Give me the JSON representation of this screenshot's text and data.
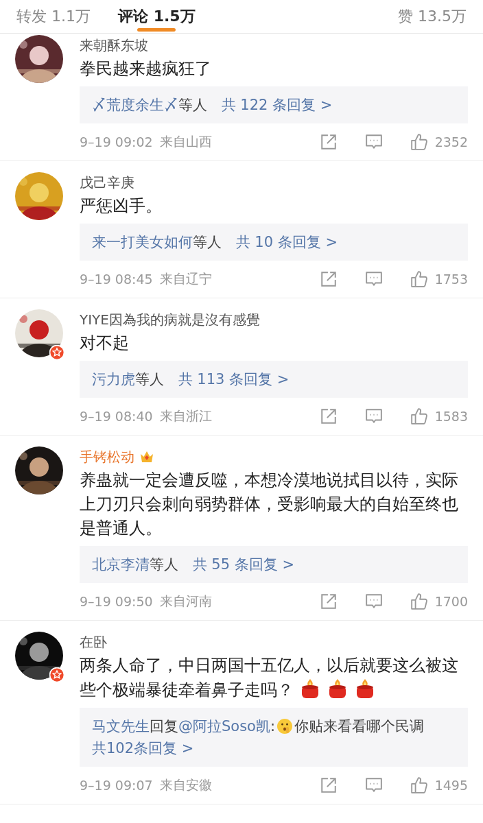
{
  "tabs": [
    {
      "label": "转发 1.1万",
      "selected": false
    },
    {
      "label": "评论 1.5万",
      "selected": true
    },
    {
      "label": "赞 13.5万",
      "selected": false
    }
  ],
  "comments": [
    {
      "user": "来朝酥东坡",
      "verified": false,
      "vip": false,
      "text": "拳民越来越疯狂了",
      "reply_preview": {
        "kind": "summary",
        "names": "〆荒度余生〆",
        "suffix": "等人",
        "count_link": "共 122 条回复 >"
      },
      "time": "9–19 09:02",
      "location": "来自山西",
      "likes": "2352"
    },
    {
      "user": "戊己辛庚",
      "verified": false,
      "vip": false,
      "text": "严惩凶手。",
      "reply_preview": {
        "kind": "summary",
        "names": "来一打美女如何",
        "suffix": "等人",
        "count_link": "共 10 条回复 >"
      },
      "time": "9–19 08:45",
      "location": "来自辽宁",
      "likes": "1753"
    },
    {
      "user": "YIYE因為我的病就是沒有感覺",
      "verified": true,
      "vip": false,
      "text": "对不起",
      "reply_preview": {
        "kind": "summary",
        "names": "污力虎",
        "suffix": "等人",
        "count_link": "共 113 条回复 >"
      },
      "time": "9–19 08:40",
      "location": "来自浙江",
      "likes": "1583"
    },
    {
      "user": "手铐松动",
      "verified": false,
      "vip": true,
      "text": "养蛊就一定会遭反噬，本想冷漠地说拭目以待，实际上刀刃只会刺向弱势群体，受影响最大的自始至终也是普通人。",
      "reply_preview": {
        "kind": "summary",
        "names": "北京李清",
        "suffix": "等人",
        "count_link": "共 55 条回复 >"
      },
      "time": "9–19 09:50",
      "location": "来自河南",
      "likes": "1700"
    },
    {
      "user": "在卧",
      "verified": true,
      "vip": false,
      "text": "两条人命了，中日两国十五亿人，以后就要这么被这些个极端暴徒牵着鼻子走吗？",
      "trailing_icons": [
        {
          "kind": "candle"
        },
        {
          "kind": "candle"
        },
        {
          "kind": "candle"
        }
      ],
      "reply_preview": {
        "kind": "quote",
        "names": "马文先生",
        "verb": "回复",
        "mention": "@阿拉Soso凯",
        "colon": ":",
        "emoji": {
          "kind": "shush"
        },
        "quote": "你贴来看看哪个民调",
        "count_link": "共102条回复 >"
      },
      "time": "9–19 09:07",
      "location": "来自安徽",
      "likes": "1495"
    }
  ]
}
